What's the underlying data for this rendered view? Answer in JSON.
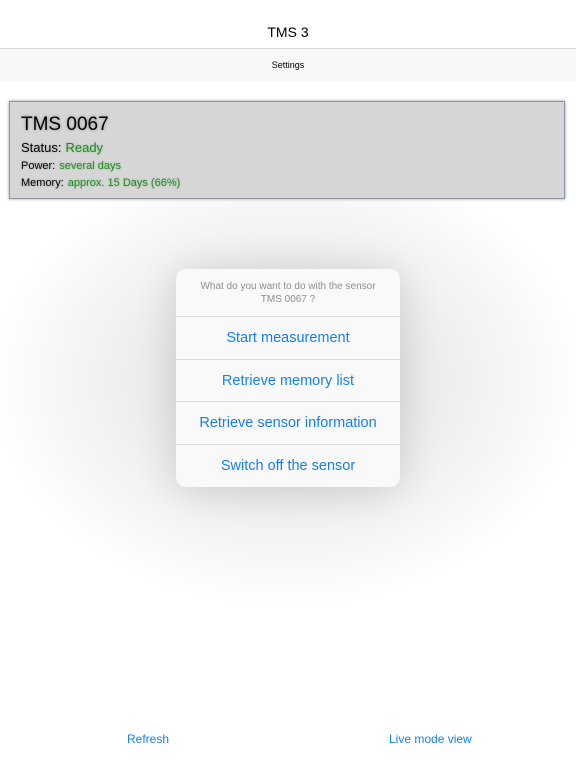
{
  "nav": {
    "title": "TMS 3"
  },
  "settings": {
    "label": "Settings"
  },
  "sensor": {
    "name": "TMS 0067",
    "status_label": "Status:",
    "status_value": "Ready",
    "power_label": "Power:",
    "power_value": "several days",
    "memory_label": "Memory:",
    "memory_value": "approx. 15 Days (66%)"
  },
  "action_sheet": {
    "message_line1": "What do you want to do with the sensor",
    "message_line2": "TMS 0067 ?",
    "actions": [
      {
        "label": "Start measurement"
      },
      {
        "label": "Retrieve memory list"
      },
      {
        "label": "Retrieve sensor information"
      },
      {
        "label": "Switch off the sensor"
      }
    ]
  },
  "toolbar": {
    "refresh_label": "Refresh",
    "live_mode_label": "Live mode view"
  },
  "colors": {
    "accent": "#157efb",
    "status_green": "#1e8a1e",
    "card_background": "#d6d6d6"
  }
}
